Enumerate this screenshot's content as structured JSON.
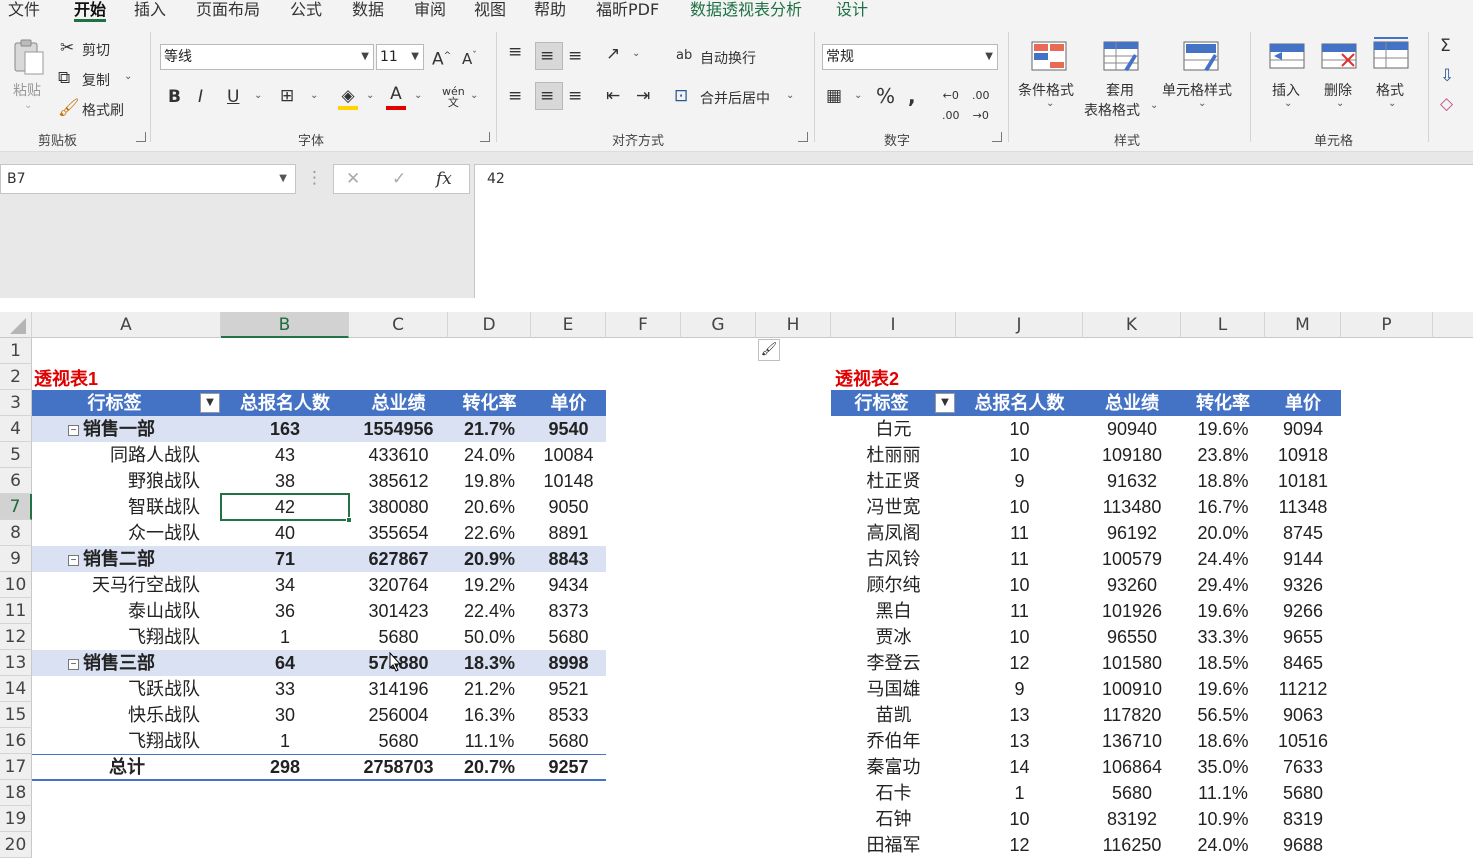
{
  "menu": {
    "tabs": [
      "文件",
      "开始",
      "插入",
      "页面布局",
      "公式",
      "数据",
      "审阅",
      "视图",
      "帮助",
      "福昕PDF",
      "数据透视表分析",
      "设计"
    ],
    "active_tab": "开始"
  },
  "ribbon": {
    "clipboard": {
      "group": "剪贴板",
      "paste": "粘贴",
      "cut": "剪切",
      "copy": "复制",
      "format_painter": "格式刷"
    },
    "font": {
      "group": "字体",
      "font_name": "等线",
      "font_size": "11",
      "bold": "B",
      "italic": "I",
      "underline": "U"
    },
    "alignment": {
      "group": "对齐方式",
      "wrap_text": "自动换行",
      "merge_center": "合并后居中"
    },
    "number": {
      "group": "数字",
      "format": "常规"
    },
    "styles": {
      "group": "样式",
      "conditional": "条件格式",
      "table_format_1": "套用",
      "table_format_2": "表格格式",
      "cell_styles": "单元格样式"
    },
    "cells": {
      "group": "单元格",
      "insert": "插入",
      "delete": "删除",
      "format": "格式"
    }
  },
  "formula_bar": {
    "name_box": "B7",
    "formula": "42"
  },
  "grid": {
    "columns": [
      "A",
      "B",
      "C",
      "D",
      "E",
      "F",
      "G",
      "H",
      "I",
      "J",
      "K",
      "L",
      "M",
      "P"
    ],
    "rows": [
      "1",
      "2",
      "3",
      "4",
      "5",
      "6",
      "7",
      "8",
      "9",
      "10",
      "11",
      "12",
      "13",
      "14",
      "15",
      "16",
      "17",
      "18",
      "19",
      "20"
    ],
    "selected_column": "B",
    "selected_row": "7"
  },
  "pivot1": {
    "title": "透视表1",
    "headers": [
      "行标签",
      "总报名人数",
      "总业绩",
      "转化率",
      "单价"
    ],
    "rows": [
      {
        "label": "销售一部",
        "type": "group",
        "values": [
          "163",
          "1554956",
          "21.7%",
          "9540"
        ]
      },
      {
        "label": "同路人战队",
        "type": "item",
        "values": [
          "43",
          "433610",
          "24.0%",
          "10084"
        ]
      },
      {
        "label": "野狼战队",
        "type": "item",
        "values": [
          "38",
          "385612",
          "19.8%",
          "10148"
        ]
      },
      {
        "label": "智联战队",
        "type": "item",
        "values": [
          "42",
          "380080",
          "20.6%",
          "9050"
        ]
      },
      {
        "label": "众一战队",
        "type": "item",
        "values": [
          "40",
          "355654",
          "22.6%",
          "8891"
        ]
      },
      {
        "label": "销售二部",
        "type": "group",
        "values": [
          "71",
          "627867",
          "20.9%",
          "8843"
        ]
      },
      {
        "label": "天马行空战队",
        "type": "item",
        "values": [
          "34",
          "320764",
          "19.2%",
          "9434"
        ]
      },
      {
        "label": "泰山战队",
        "type": "item",
        "values": [
          "36",
          "301423",
          "22.4%",
          "8373"
        ]
      },
      {
        "label": "飞翔战队",
        "type": "item",
        "values": [
          "1",
          "5680",
          "50.0%",
          "5680"
        ]
      },
      {
        "label": "销售三部",
        "type": "group",
        "values": [
          "64",
          "575880",
          "18.3%",
          "8998"
        ]
      },
      {
        "label": "飞跃战队",
        "type": "item",
        "values": [
          "33",
          "314196",
          "21.2%",
          "9521"
        ]
      },
      {
        "label": "快乐战队",
        "type": "item",
        "values": [
          "30",
          "256004",
          "16.3%",
          "8533"
        ]
      },
      {
        "label": "飞翔战队",
        "type": "item",
        "values": [
          "1",
          "5680",
          "11.1%",
          "5680"
        ]
      },
      {
        "label": "总计",
        "type": "total",
        "values": [
          "298",
          "2758703",
          "20.7%",
          "9257"
        ]
      }
    ]
  },
  "pivot2": {
    "title": "透视表2",
    "headers": [
      "行标签",
      "总报名人数",
      "总业绩",
      "转化率",
      "单价"
    ],
    "rows": [
      {
        "label": "白元",
        "values": [
          "10",
          "90940",
          "19.6%",
          "9094"
        ]
      },
      {
        "label": "杜丽丽",
        "values": [
          "10",
          "109180",
          "23.8%",
          "10918"
        ]
      },
      {
        "label": "杜正贤",
        "values": [
          "9",
          "91632",
          "18.8%",
          "10181"
        ]
      },
      {
        "label": "冯世宽",
        "values": [
          "10",
          "113480",
          "16.7%",
          "11348"
        ]
      },
      {
        "label": "高凤阁",
        "values": [
          "11",
          "96192",
          "20.0%",
          "8745"
        ]
      },
      {
        "label": "古风铃",
        "values": [
          "11",
          "100579",
          "24.4%",
          "9144"
        ]
      },
      {
        "label": "顾尔纯",
        "values": [
          "10",
          "93260",
          "29.4%",
          "9326"
        ]
      },
      {
        "label": "黑白",
        "values": [
          "11",
          "101926",
          "19.6%",
          "9266"
        ]
      },
      {
        "label": "贾冰",
        "values": [
          "10",
          "96550",
          "33.3%",
          "9655"
        ]
      },
      {
        "label": "李登云",
        "values": [
          "12",
          "101580",
          "18.5%",
          "8465"
        ]
      },
      {
        "label": "马国雄",
        "values": [
          "9",
          "100910",
          "19.6%",
          "11212"
        ]
      },
      {
        "label": "苗凯",
        "values": [
          "13",
          "117820",
          "56.5%",
          "9063"
        ]
      },
      {
        "label": "乔伯年",
        "values": [
          "13",
          "136710",
          "18.6%",
          "10516"
        ]
      },
      {
        "label": "秦富功",
        "values": [
          "14",
          "106864",
          "35.0%",
          "7633"
        ]
      },
      {
        "label": "石卡",
        "values": [
          "1",
          "5680",
          "11.1%",
          "5680"
        ]
      },
      {
        "label": "石钟",
        "values": [
          "10",
          "83192",
          "10.9%",
          "8319"
        ]
      },
      {
        "label": "田福军",
        "values": [
          "12",
          "116250",
          "24.0%",
          "9688"
        ]
      }
    ]
  }
}
